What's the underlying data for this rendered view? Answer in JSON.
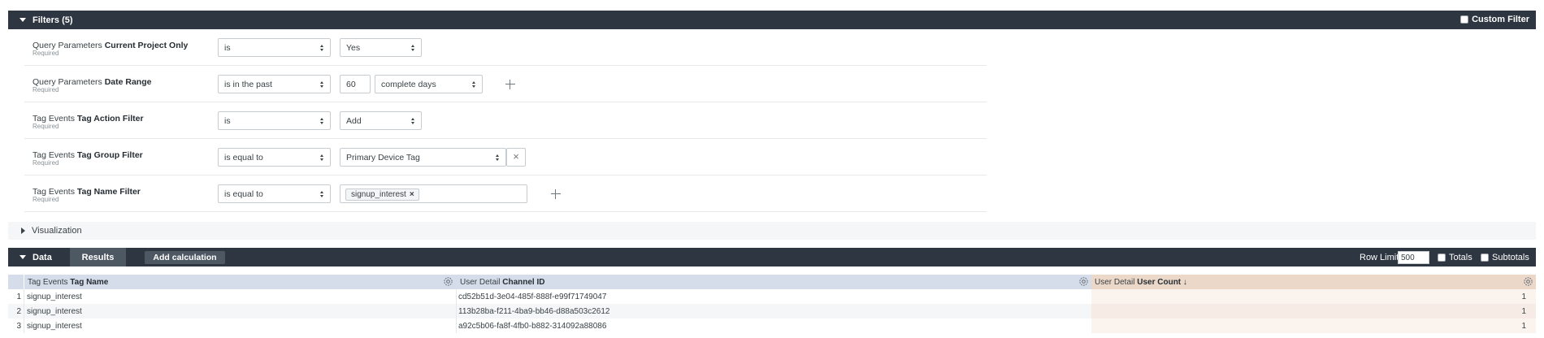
{
  "filters_section": {
    "title": "Filters (5)",
    "custom_filter_label": "Custom Filter",
    "rows": [
      {
        "label_prefix": "Query Parameters",
        "label_field": "Current Project Only",
        "required": "Required",
        "operator": "is",
        "value": "Yes"
      },
      {
        "label_prefix": "Query Parameters",
        "label_field": "Date Range",
        "required": "Required",
        "operator": "is in the past",
        "number": "60",
        "unit": "complete days"
      },
      {
        "label_prefix": "Tag Events",
        "label_field": "Tag Action Filter",
        "required": "Required",
        "operator": "is",
        "value": "Add"
      },
      {
        "label_prefix": "Tag Events",
        "label_field": "Tag Group Filter",
        "required": "Required",
        "operator": "is equal to",
        "value": "Primary Device Tag"
      },
      {
        "label_prefix": "Tag Events",
        "label_field": "Tag Name Filter",
        "required": "Required",
        "operator": "is equal to",
        "chip": "signup_interest"
      }
    ]
  },
  "visualization": {
    "label": "Visualization"
  },
  "data_section": {
    "title": "Data",
    "tab_results": "Results",
    "add_calculation": "Add calculation",
    "row_limit_label": "Row Limit",
    "row_limit_value": "500",
    "totals_label": "Totals",
    "subtotals_label": "Subtotals"
  },
  "table": {
    "columns": [
      {
        "prefix": "Tag Events",
        "name": "Tag Name"
      },
      {
        "prefix": "User Detail",
        "name": "Channel ID"
      },
      {
        "prefix": "User Detail",
        "name": "User Count ↓"
      }
    ],
    "rows": [
      {
        "index": "1",
        "tag_name": "signup_interest",
        "channel_id": "cd52b51d-3e04-485f-888f-e99f71749047",
        "user_count": "1"
      },
      {
        "index": "2",
        "tag_name": "signup_interest",
        "channel_id": "113b28ba-f211-4ba9-bb46-d88a503c2612",
        "user_count": "1"
      },
      {
        "index": "3",
        "tag_name": "signup_interest",
        "channel_id": "a92c5b06-fa8f-4fb0-b882-314092a88086",
        "user_count": "1"
      }
    ]
  },
  "colors": {
    "header_bar": "#2e3641",
    "dimension_header": "#d4dde9",
    "measure_header": "#ebd8c9"
  }
}
